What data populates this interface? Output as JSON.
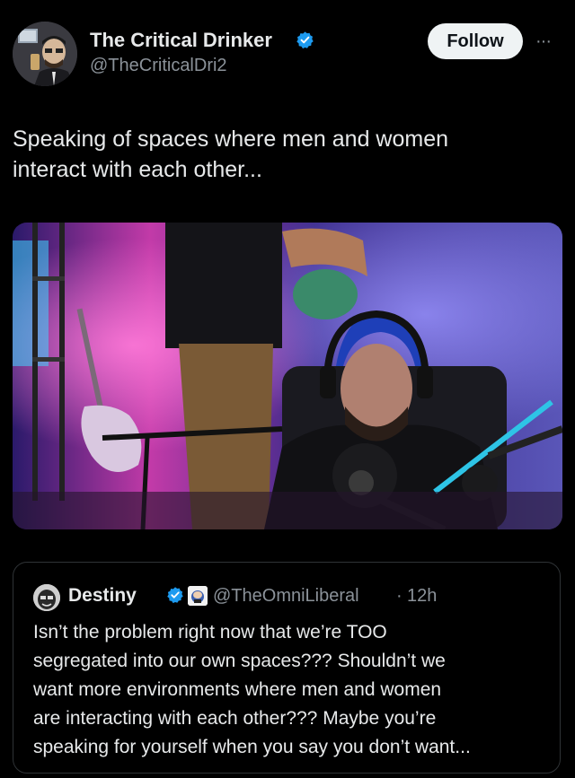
{
  "author": {
    "name": "The Critical Drinker",
    "handle": "@TheCriticalDri2",
    "verified_icon": "verified-badge-icon",
    "avatar_icon": "avatar-image"
  },
  "actions": {
    "follow_label": "Follow",
    "more_label": "···"
  },
  "tweet": {
    "text_line1": "Speaking of spaces where men and women",
    "text_line2": "interact with each other..."
  },
  "media": {
    "kind": "video-thumbnail"
  },
  "quoted_tweet": {
    "name": "Destiny",
    "handle": "@TheOmniLiberal",
    "separator": "·",
    "time": "12h",
    "lines": [
      "Isn’t the problem right now that we’re TOO",
      "segregated into our own spaces??? Shouldn’t we",
      "want more environments where men and women",
      "are interacting with each other??? Maybe you’re",
      "speaking for yourself when you say you don’t want..."
    ]
  },
  "colors": {
    "background": "#000000",
    "text_primary": "#e7e9ea",
    "text_secondary": "#8b9299",
    "verified_blue": "#1d9bf0",
    "follow_bg": "#eff3f4",
    "border": "#2f3336"
  }
}
